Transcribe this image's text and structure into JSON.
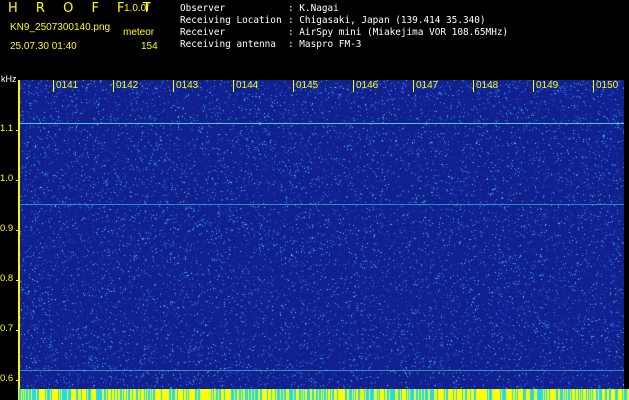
{
  "header": {
    "app_title": "H R O F F T",
    "version": "1.0.0f",
    "filename": "KN9_2507300140.png",
    "mode": "meteor",
    "timestamp": "25.07.30 01:40",
    "count": "154",
    "info": [
      {
        "label": "Observer",
        "value": ": K.Nagai"
      },
      {
        "label": "Receiving Location",
        "value": ": Chigasaki, Japan (139.414 35.340)"
      },
      {
        "label": "Receiver",
        "value": ": AirSpy mini (Miakejima VOR 108.65MHz)"
      },
      {
        "label": "Receiving antenna",
        "value": ": Maspro FM-3"
      }
    ]
  },
  "spectrogram": {
    "y_unit": "kHz",
    "y_ticks": [
      "1.1",
      "1.0",
      "0.9",
      "0.8",
      "0.7",
      "0.6"
    ],
    "time_labels": [
      "0141",
      "0142",
      "0143",
      "0144",
      "0145",
      "0146",
      "0147",
      "0148",
      "0149",
      "0150"
    ],
    "colors": {
      "background": "#10208f",
      "noise_low": "#2b4fd8",
      "noise_mid": "#3aa0e8",
      "noise_high": "#57e8e8",
      "line": "#4cc7dc",
      "axis": "#ffff00"
    }
  }
}
